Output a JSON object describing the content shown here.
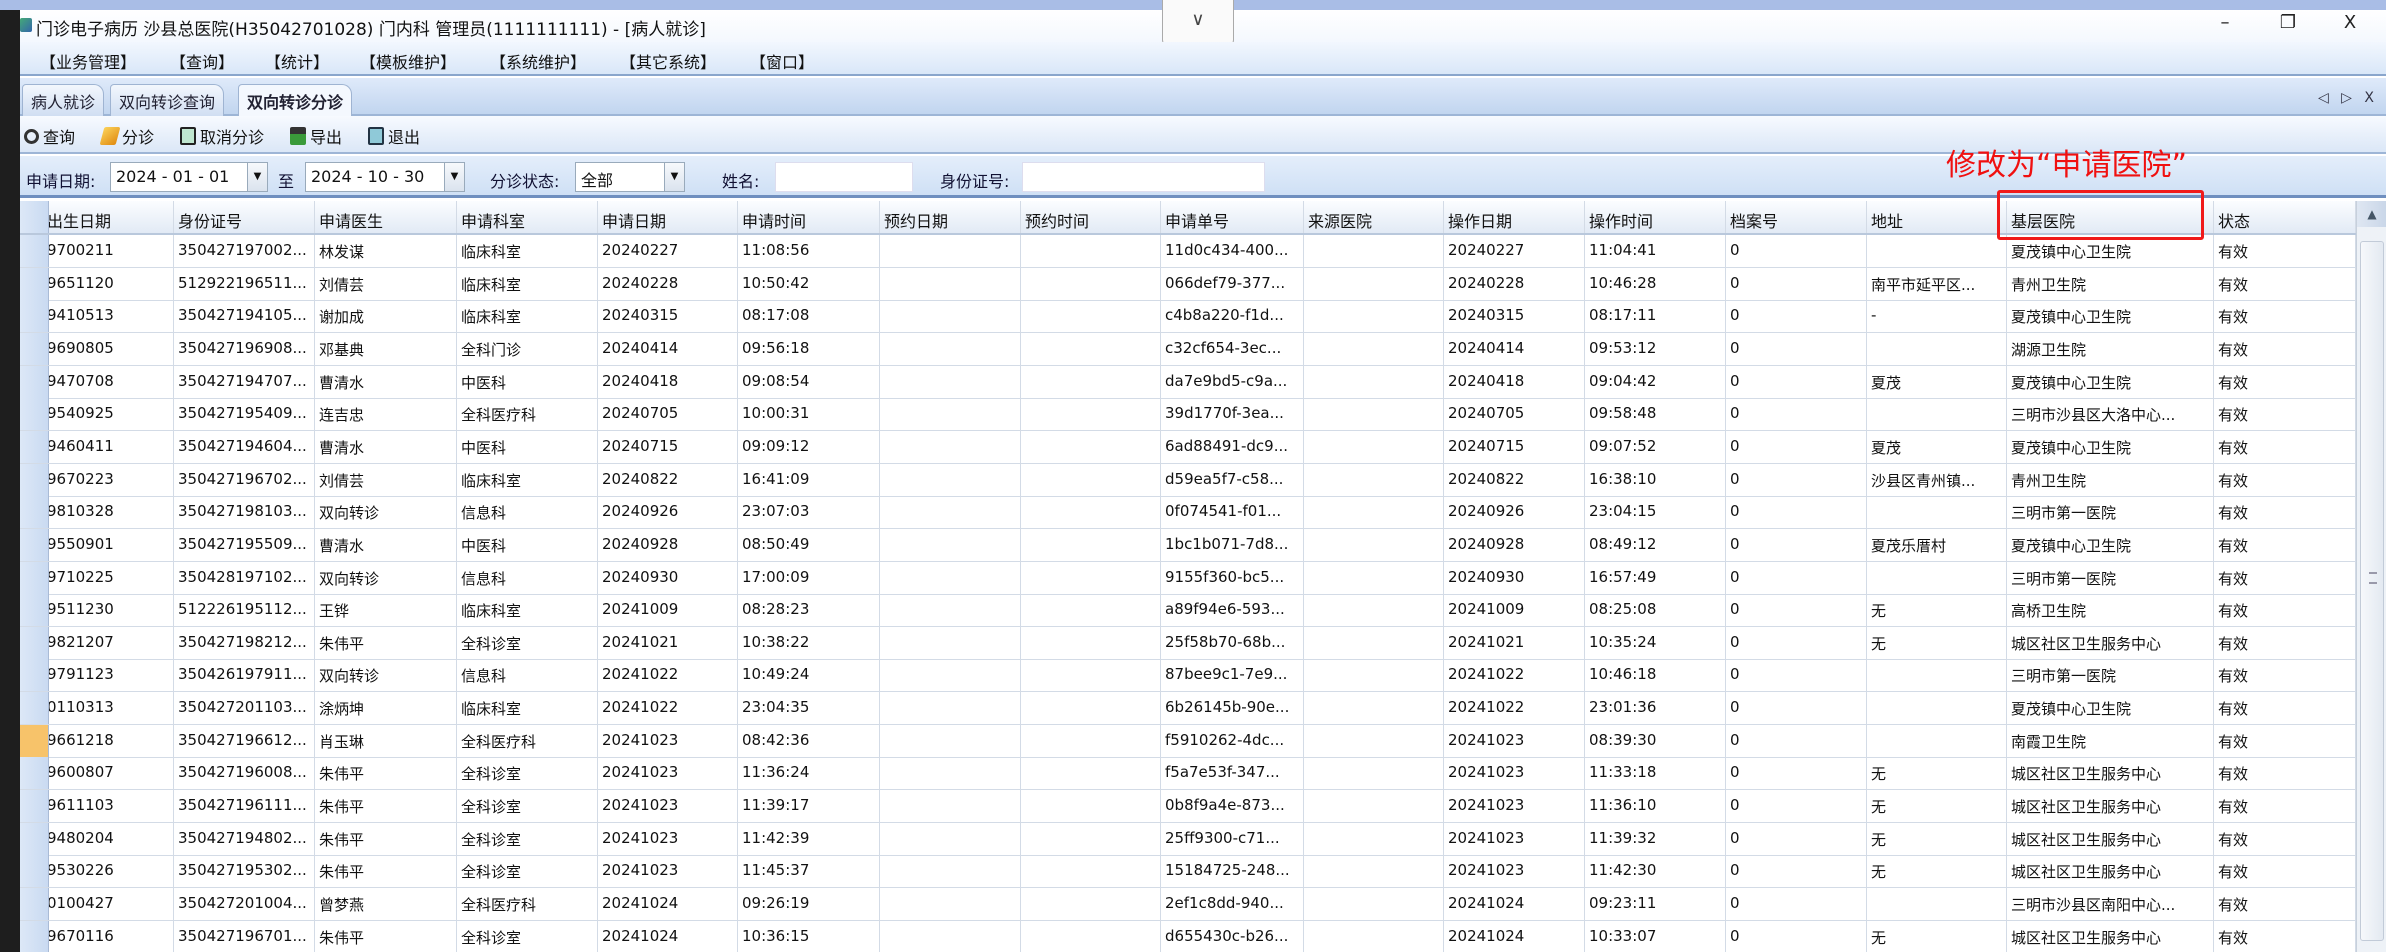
{
  "window": {
    "title": "门诊电子病历  沙县总医院(H35042701028)  门内科  管理员(1111111111) - [病人就诊]",
    "chevron": "∨",
    "minimize": "–",
    "restore": "❐",
    "close": "X"
  },
  "menu": [
    "【业务管理】",
    "【查询】",
    "【统计】",
    "【模板维护】",
    "【系统维护】",
    "【其它系统】",
    "【窗口】"
  ],
  "tabs": [
    "病人就诊",
    "双向转诊查询",
    "双向转诊分诊"
  ],
  "tab_controls": "◁ ▷ X",
  "toolbar": {
    "query": "查询",
    "triage": "分诊",
    "cancel_triage": "取消分诊",
    "export": "导出",
    "exit": "退出"
  },
  "filter": {
    "date_label": "申请日期:",
    "date_from": "2024 - 01 - 01",
    "to_label": "至",
    "date_to": "2024 - 10 - 30",
    "status_label": "分诊状态:",
    "status_value": "全部",
    "name_label": "姓名:",
    "name_value": "",
    "id_label": "身份证号:",
    "id_value": ""
  },
  "annotation": "修改为“申请医院”",
  "colors": {
    "accent_red": "#f01a1a",
    "selected_row_marker": "#f7c36a"
  },
  "table": {
    "columns": [
      "出生日期",
      "身份证号",
      "申请医生",
      "申请科室",
      "申请日期",
      "申请时间",
      "预约日期",
      "预约时间",
      "申请单号",
      "来源医院",
      "操作日期",
      "操作时间",
      "档案号",
      "地址",
      "基层医院",
      "状态"
    ],
    "selected_row": 15,
    "rows": [
      [
        "9700211",
        "350427197002...",
        "林发谋",
        "临床科室",
        "20240227",
        "11:08:56",
        "",
        "",
        "11d0c434-400...",
        "",
        "20240227",
        "11:04:41",
        "0",
        "",
        "夏茂镇中心卫生院",
        "有效"
      ],
      [
        "9651120",
        "512922196511...",
        "刘倩芸",
        "临床科室",
        "20240228",
        "10:50:42",
        "",
        "",
        "066def79-377...",
        "",
        "20240228",
        "10:46:28",
        "0",
        "南平市延平区...",
        "青州卫生院",
        "有效"
      ],
      [
        "9410513",
        "350427194105...",
        "谢加成",
        "临床科室",
        "20240315",
        "08:17:08",
        "",
        "",
        "c4b8a220-f1d...",
        "",
        "20240315",
        "08:17:11",
        "0",
        "-",
        "夏茂镇中心卫生院",
        "有效"
      ],
      [
        "9690805",
        "350427196908...",
        "邓基典",
        "全科门诊",
        "20240414",
        "09:56:18",
        "",
        "",
        "c32cf654-3ec...",
        "",
        "20240414",
        "09:53:12",
        "0",
        "",
        "湖源卫生院",
        "有效"
      ],
      [
        "9470708",
        "350427194707...",
        "曹清水",
        "中医科",
        "20240418",
        "09:08:54",
        "",
        "",
        "da7e9bd5-c9a...",
        "",
        "20240418",
        "09:04:42",
        "0",
        "夏茂",
        "夏茂镇中心卫生院",
        "有效"
      ],
      [
        "9540925",
        "350427195409...",
        "连吉忠",
        "全科医疗科",
        "20240705",
        "10:00:31",
        "",
        "",
        "39d1770f-3ea...",
        "",
        "20240705",
        "09:58:48",
        "0",
        "",
        "三明市沙县区大洛中心...",
        "有效"
      ],
      [
        "9460411",
        "350427194604...",
        "曹清水",
        "中医科",
        "20240715",
        "09:09:12",
        "",
        "",
        "6ad88491-dc9...",
        "",
        "20240715",
        "09:07:52",
        "0",
        "夏茂",
        "夏茂镇中心卫生院",
        "有效"
      ],
      [
        "9670223",
        "350427196702...",
        "刘倩芸",
        "临床科室",
        "20240822",
        "16:41:09",
        "",
        "",
        "d59ea5f7-c58...",
        "",
        "20240822",
        "16:38:10",
        "0",
        "沙县区青州镇...",
        "青州卫生院",
        "有效"
      ],
      [
        "9810328",
        "350427198103...",
        "双向转诊",
        "信息科",
        "20240926",
        "23:07:03",
        "",
        "",
        "0f074541-f01...",
        "",
        "20240926",
        "23:04:15",
        "0",
        "",
        "三明市第一医院",
        "有效"
      ],
      [
        "9550901",
        "350427195509...",
        "曹清水",
        "中医科",
        "20240928",
        "08:50:49",
        "",
        "",
        "1bc1b071-7d8...",
        "",
        "20240928",
        "08:49:12",
        "0",
        "夏茂乐厝村",
        "夏茂镇中心卫生院",
        "有效"
      ],
      [
        "9710225",
        "350428197102...",
        "双向转诊",
        "信息科",
        "20240930",
        "17:00:09",
        "",
        "",
        "9155f360-bc5...",
        "",
        "20240930",
        "16:57:49",
        "0",
        "",
        "三明市第一医院",
        "有效"
      ],
      [
        "9511230",
        "512226195112...",
        "王铧",
        "临床科室",
        "20241009",
        "08:28:23",
        "",
        "",
        "a89f94e6-593...",
        "",
        "20241009",
        "08:25:08",
        "0",
        "无",
        "高桥卫生院",
        "有效"
      ],
      [
        "9821207",
        "350427198212...",
        "朱伟平",
        "全科诊室",
        "20241021",
        "10:38:22",
        "",
        "",
        "25f58b70-68b...",
        "",
        "20241021",
        "10:35:24",
        "0",
        "无",
        "城区社区卫生服务中心",
        "有效"
      ],
      [
        "9791123",
        "350426197911...",
        "双向转诊",
        "信息科",
        "20241022",
        "10:49:24",
        "",
        "",
        "87bee9c1-7e9...",
        "",
        "20241022",
        "10:46:18",
        "0",
        "",
        "三明市第一医院",
        "有效"
      ],
      [
        "0110313",
        "350427201103...",
        "涂炳坤",
        "临床科室",
        "20241022",
        "23:04:35",
        "",
        "",
        "6b26145b-90e...",
        "",
        "20241022",
        "23:01:36",
        "0",
        "",
        "夏茂镇中心卫生院",
        "有效"
      ],
      [
        "9661218",
        "350427196612...",
        "肖玉琳",
        "全科医疗科",
        "20241023",
        "08:42:36",
        "",
        "",
        "f5910262-4dc...",
        "",
        "20241023",
        "08:39:30",
        "0",
        "",
        "南霞卫生院",
        "有效"
      ],
      [
        "9600807",
        "350427196008...",
        "朱伟平",
        "全科诊室",
        "20241023",
        "11:36:24",
        "",
        "",
        "f5a7e53f-347...",
        "",
        "20241023",
        "11:33:18",
        "0",
        "无",
        "城区社区卫生服务中心",
        "有效"
      ],
      [
        "9611103",
        "350427196111...",
        "朱伟平",
        "全科诊室",
        "20241023",
        "11:39:17",
        "",
        "",
        "0b8f9a4e-873...",
        "",
        "20241023",
        "11:36:10",
        "0",
        "无",
        "城区社区卫生服务中心",
        "有效"
      ],
      [
        "9480204",
        "350427194802...",
        "朱伟平",
        "全科诊室",
        "20241023",
        "11:42:39",
        "",
        "",
        "25ff9300-c71...",
        "",
        "20241023",
        "11:39:32",
        "0",
        "无",
        "城区社区卫生服务中心",
        "有效"
      ],
      [
        "9530226",
        "350427195302...",
        "朱伟平",
        "全科诊室",
        "20241023",
        "11:45:37",
        "",
        "",
        "15184725-248...",
        "",
        "20241023",
        "11:42:30",
        "0",
        "无",
        "城区社区卫生服务中心",
        "有效"
      ],
      [
        "0100427",
        "350427201004...",
        "曾梦燕",
        "全科医疗科",
        "20241024",
        "09:26:19",
        "",
        "",
        "2ef1c8dd-940...",
        "",
        "20241024",
        "09:23:11",
        "0",
        "",
        "三明市沙县区南阳中心...",
        "有效"
      ],
      [
        "9670116",
        "350427196701...",
        "朱伟平",
        "全科诊室",
        "20241024",
        "10:36:15",
        "",
        "",
        "d655430c-b26...",
        "",
        "20241024",
        "10:33:07",
        "0",
        "无",
        "城区社区卫生服务中心",
        "有效"
      ]
    ]
  }
}
